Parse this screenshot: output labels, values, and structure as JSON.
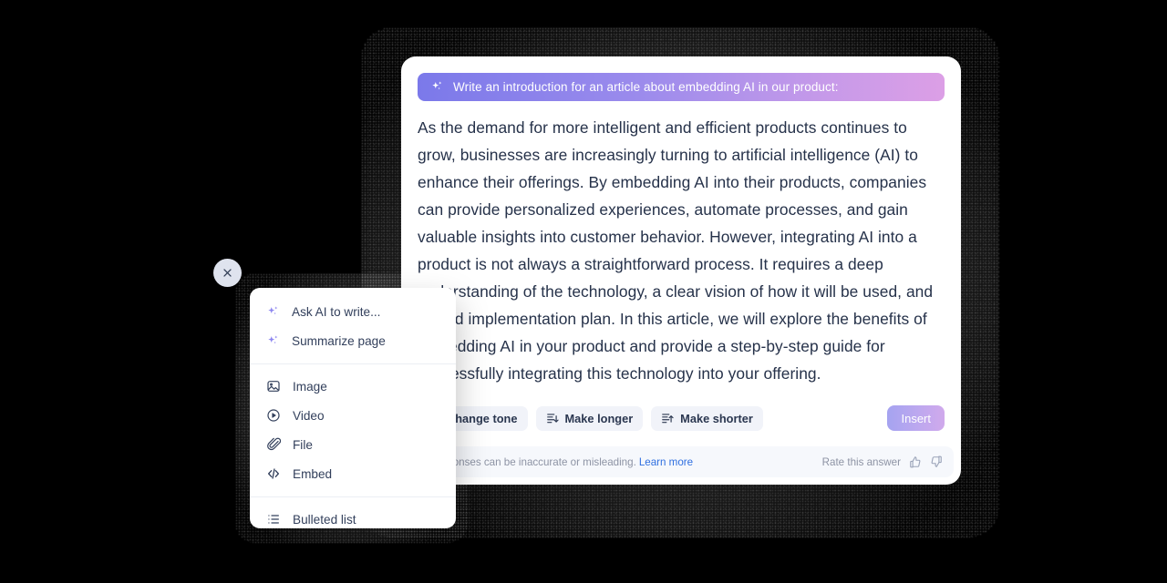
{
  "ai_card": {
    "prompt": {
      "icon": "sparkle-icon",
      "text": "Write an introduction for an article about embedding AI in our product:"
    },
    "answer": "As the demand for more intelligent and efficient products continues to grow, businesses are increasingly turning to artificial intelligence (AI) to enhance their offerings. By embedding AI into their products, companies can provide personalized experiences, automate processes, and gain valuable insights into customer behavior. However, integrating AI into a product is not always a straightforward process. It requires a deep understanding of the technology, a clear vision of how it will be used, and a solid implementation plan. In this article, we will explore the benefits of embedding AI in your product and provide a step-by-step guide for successfully integrating this technology into your offering.",
    "actions": [
      {
        "label": "Change tone",
        "icon": "megaphone-icon"
      },
      {
        "label": "Make longer",
        "icon": "lines-arrow-down-icon"
      },
      {
        "label": "Make shorter",
        "icon": "lines-arrow-up-icon"
      }
    ],
    "insert_label": "Insert",
    "footer": {
      "disclaimer": "AI responses can be inaccurate or misleading.",
      "learn_more": "Learn more",
      "rate_label": "Rate this answer",
      "thumb_up_icon": "thumbs-up-icon",
      "thumb_down_icon": "thumbs-down-icon"
    }
  },
  "slash_menu": {
    "groups": [
      {
        "items": [
          {
            "label": "Ask AI to write...",
            "icon": "sparkle-icon"
          },
          {
            "label": "Summarize page",
            "icon": "sparkle-icon"
          }
        ]
      },
      {
        "items": [
          {
            "label": "Image",
            "icon": "image-icon"
          },
          {
            "label": "Video",
            "icon": "video-play-icon"
          },
          {
            "label": "File",
            "icon": "paperclip-icon"
          },
          {
            "label": "Embed",
            "icon": "code-embed-icon"
          }
        ]
      },
      {
        "items": [
          {
            "label": "Bulleted list",
            "icon": "bulleted-list-icon"
          }
        ]
      }
    ]
  },
  "close_button": {
    "icon": "close-icon",
    "label": "Close"
  },
  "colors": {
    "gradient_start": "#7b79ea",
    "gradient_end": "#dc9fe6",
    "text_primary": "#26324a",
    "text_muted": "#8d93a4",
    "link": "#2f6fe0",
    "chip_bg": "#f1f3f9",
    "footer_bg": "#f6f8fc",
    "sparkle_purple": "#8d86f0",
    "background": "#000000"
  }
}
